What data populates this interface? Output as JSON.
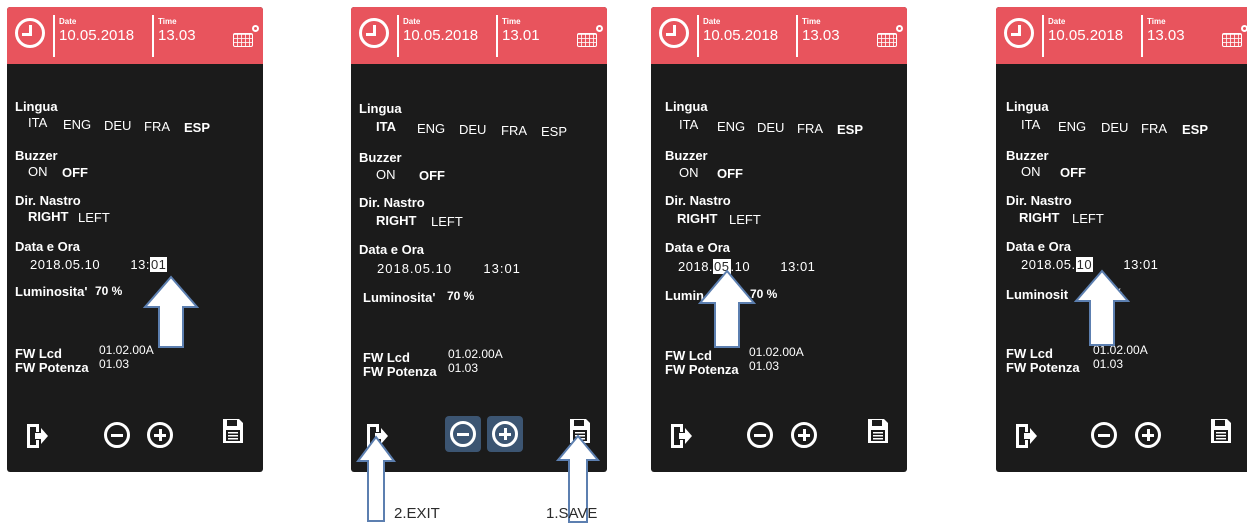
{
  "colors": {
    "header": "#e8545d",
    "screen": "#1b1b1b",
    "button_highlight": "#3c5572"
  },
  "panels": [
    {
      "header": {
        "date_label": "Date",
        "date_value": "10.05.2018",
        "time_label": "Time",
        "time_value": "13.03"
      },
      "lingua": {
        "title": "Lingua",
        "options": [
          "ITA",
          "ENG",
          "DEU",
          "FRA",
          "ESP"
        ]
      },
      "buzzer": {
        "title": "Buzzer",
        "options": [
          "ON",
          "OFF"
        ]
      },
      "nastro": {
        "title": "Dir. Nastro",
        "options": [
          "RIGHT",
          "LEFT"
        ]
      },
      "data_ora": {
        "title": "Data e Ora",
        "year": "2018",
        "month": "05",
        "day": "10",
        "hour": "13",
        "minute": "01"
      },
      "luminosita": {
        "label": "Luminosita'",
        "value": "70 %"
      },
      "fw": {
        "lcd_label": "FW Lcd",
        "lcd_value": "01.02.00A",
        "pot_label": "FW Potenza",
        "pot_value": "01.03"
      }
    },
    {
      "header": {
        "date_label": "Date",
        "date_value": "10.05.2018",
        "time_label": "Time",
        "time_value": "13.01"
      },
      "lingua": {
        "title": "Lingua",
        "options": [
          "ITA",
          "ENG",
          "DEU",
          "FRA",
          "ESP"
        ]
      },
      "buzzer": {
        "title": "Buzzer",
        "options": [
          "ON",
          "OFF"
        ]
      },
      "nastro": {
        "title": "Dir. Nastro",
        "options": [
          "RIGHT",
          "LEFT"
        ]
      },
      "data_ora": {
        "title": "Data e Ora",
        "year": "2018",
        "month": "05",
        "day": "10",
        "hour": "13",
        "minute": "01"
      },
      "luminosita": {
        "label": "Luminosita'",
        "value": "70 %"
      },
      "fw": {
        "lcd_label": "FW Lcd",
        "lcd_value": "01.02.00A",
        "pot_label": "FW Potenza",
        "pot_value": "01.03"
      }
    },
    {
      "header": {
        "date_label": "Date",
        "date_value": "10.05.2018",
        "time_label": "Time",
        "time_value": "13.03"
      },
      "lingua": {
        "title": "Lingua",
        "options": [
          "ITA",
          "ENG",
          "DEU",
          "FRA",
          "ESP"
        ]
      },
      "buzzer": {
        "title": "Buzzer",
        "options": [
          "ON",
          "OFF"
        ]
      },
      "nastro": {
        "title": "Dir. Nastro",
        "options": [
          "RIGHT",
          "LEFT"
        ]
      },
      "data_ora": {
        "title": "Data e Ora",
        "year": "2018",
        "month": "05",
        "day": "10",
        "hour": "13",
        "minute": "01"
      },
      "luminosita": {
        "label": "Lumin",
        "value": "70 %"
      },
      "fw": {
        "lcd_label": "FW Lcd",
        "lcd_value": "01.02.00A",
        "pot_label": "FW Potenza",
        "pot_value": "01.03"
      }
    },
    {
      "header": {
        "date_label": "Date",
        "date_value": "10.05.2018",
        "time_label": "Time",
        "time_value": "13.03"
      },
      "lingua": {
        "title": "Lingua",
        "options": [
          "ITA",
          "ENG",
          "DEU",
          "FRA",
          "ESP"
        ]
      },
      "buzzer": {
        "title": "Buzzer",
        "options": [
          "ON",
          "OFF"
        ]
      },
      "nastro": {
        "title": "Dir. Nastro",
        "options": [
          "RIGHT",
          "LEFT"
        ]
      },
      "data_ora": {
        "title": "Data e Ora",
        "year": "2018",
        "month": "05",
        "day": "10",
        "hour": "13",
        "minute": "01"
      },
      "luminosita": {
        "label": "Luminosit",
        "value": "%"
      },
      "fw": {
        "lcd_label": "FW Lcd",
        "lcd_value": "01.02.00A",
        "pot_label": "FW Potenza",
        "pot_value": "01.03"
      }
    }
  ],
  "annotations": {
    "exit": "2.EXIT",
    "save": "1.SAVE"
  }
}
